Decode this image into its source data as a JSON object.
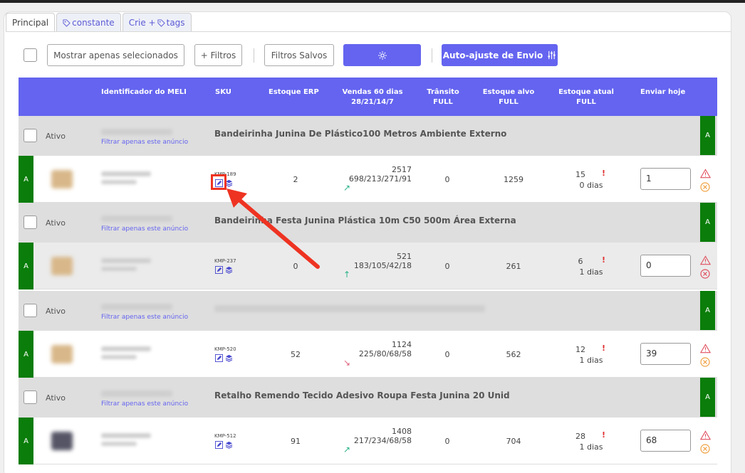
{
  "tabs": [
    {
      "label": "Principal"
    },
    {
      "label": "constante"
    },
    {
      "label": "Crie + ",
      "suffix": "tags"
    }
  ],
  "toolbar": {
    "show_selected": "Mostrar apenas selecionados",
    "filters": "+ Filtros",
    "saved_filters": "Filtros Salvos",
    "auto_adjust": "Auto-ajuste de Envio"
  },
  "table": {
    "headers": [
      "Identificador do MELI",
      "SKU",
      "Estoque ERP",
      "Vendas 60 dias",
      "28/21/14/7",
      "Trânsito",
      "FULL",
      "Estoque alvo",
      "FULL",
      "Estoque atual",
      "FULL",
      "Enviar hoje"
    ]
  },
  "groups": [
    {
      "status_label": "Ativo",
      "filter_link": "Filtrar apenas este anúncio",
      "title": "Bandeirinha Junina De Plástico100 Metros Ambiente Externo",
      "tag": "A"
    },
    {
      "status_label": "Ativo",
      "filter_link": "Filtrar apenas este anúncio",
      "title": "Bandeirinha Festa Junina Plástica 10m C50 500m Área Externa",
      "tag": "A"
    },
    {
      "status_label": "Ativo",
      "filter_link": "Filtrar apenas este anúncio",
      "title": "",
      "tag": "A"
    },
    {
      "status_label": "Ativo",
      "filter_link": "Filtrar apenas este anúncio",
      "title": "Retalho Remendo Tecido Adesivo Roupa Festa Junina 20 Unid",
      "tag": "A"
    }
  ],
  "rows": [
    {
      "tag": "A",
      "sku": "KMP-189",
      "erp": "2",
      "sales_total": "2517",
      "sales_split": "698/213/271/91",
      "trend": "up-right",
      "transit": "0",
      "target": "1259",
      "current": "15",
      "days": "0 dias",
      "send": "1"
    },
    {
      "tag": "A",
      "sku": "KMP-237",
      "erp": "0",
      "sales_total": "521",
      "sales_split": "183/105/42/18",
      "trend": "up",
      "transit": "0",
      "target": "261",
      "current": "6",
      "days": "1 dias",
      "send": "0"
    },
    {
      "tag": "A",
      "sku": "KMP-520",
      "erp": "52",
      "sales_total": "1124",
      "sales_split": "225/80/68/58",
      "trend": "down-right",
      "transit": "0",
      "target": "562",
      "current": "12",
      "days": "1 dias",
      "send": "39"
    },
    {
      "tag": "A",
      "sku": "KMP-512",
      "erp": "91",
      "sales_total": "1408",
      "sales_split": "217/234/68/58",
      "trend": "up-right",
      "transit": "0",
      "target": "704",
      "current": "28",
      "days": "1 dias",
      "send": "68"
    }
  ],
  "colors": {
    "primary": "#6464f0",
    "status_green": "#0a7d0a",
    "alert_red": "#e03030",
    "highlight": "#ee3322"
  }
}
